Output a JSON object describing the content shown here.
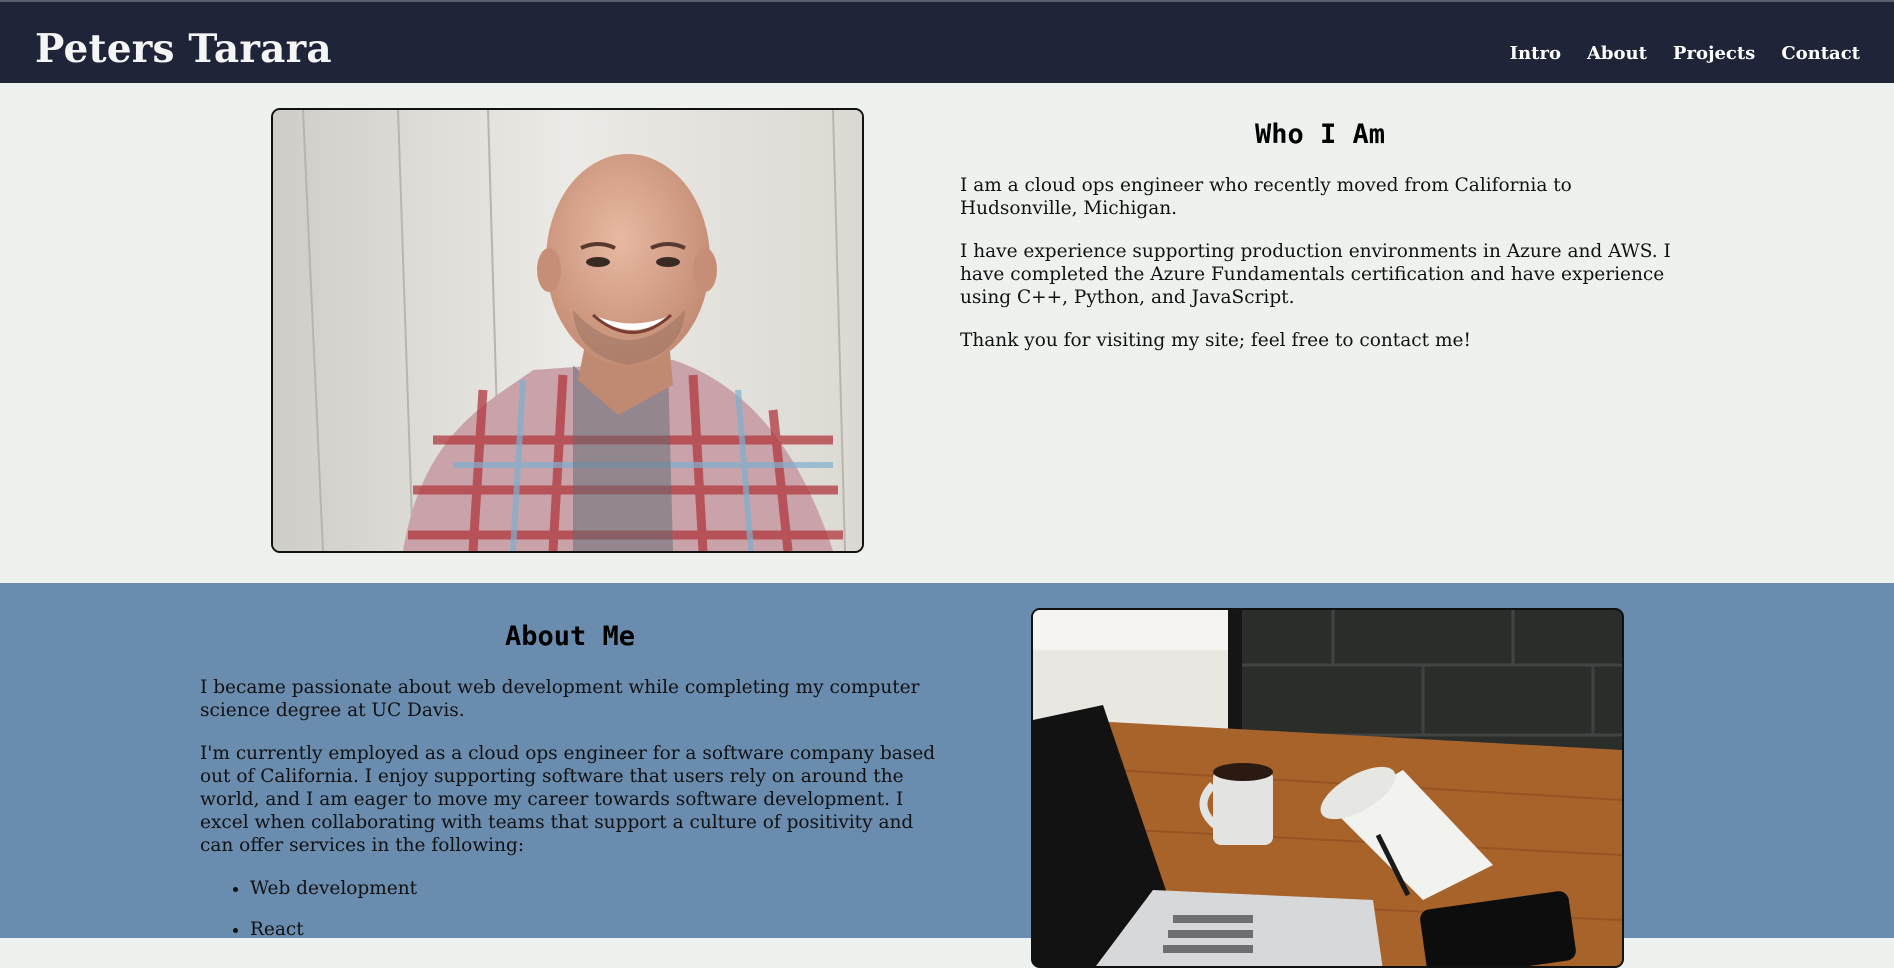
{
  "header": {
    "brand": "Peters Tarara",
    "nav": [
      "Intro",
      "About",
      "Projects",
      "Contact"
    ]
  },
  "intro": {
    "title": "Who I Am",
    "paragraphs": [
      "I am a cloud ops engineer who recently moved from California to Hudsonville, Michigan.",
      "I have experience supporting production environments in Azure and AWS. I have completed the Azure Fundamentals certification and have experience using C++, Python, and JavaScript.",
      "Thank you for visiting my site; feel free to contact me!"
    ]
  },
  "about": {
    "title": "About Me",
    "paragraphs": [
      "I became passionate about web development while completing my computer science degree at UC Davis.",
      "I'm currently employed as a cloud ops engineer for a software company based out of California. I enjoy supporting software that users rely on around the world, and I am eager to move my career towards software development. I excel when collaborating with teams that support a culture of positivity and can offer services in the following:"
    ],
    "list": [
      "Web development",
      "React"
    ]
  },
  "colors": {
    "header_bg": "#1f2438",
    "intro_bg": "#eef2ee",
    "about_bg": "#6a8cae"
  }
}
